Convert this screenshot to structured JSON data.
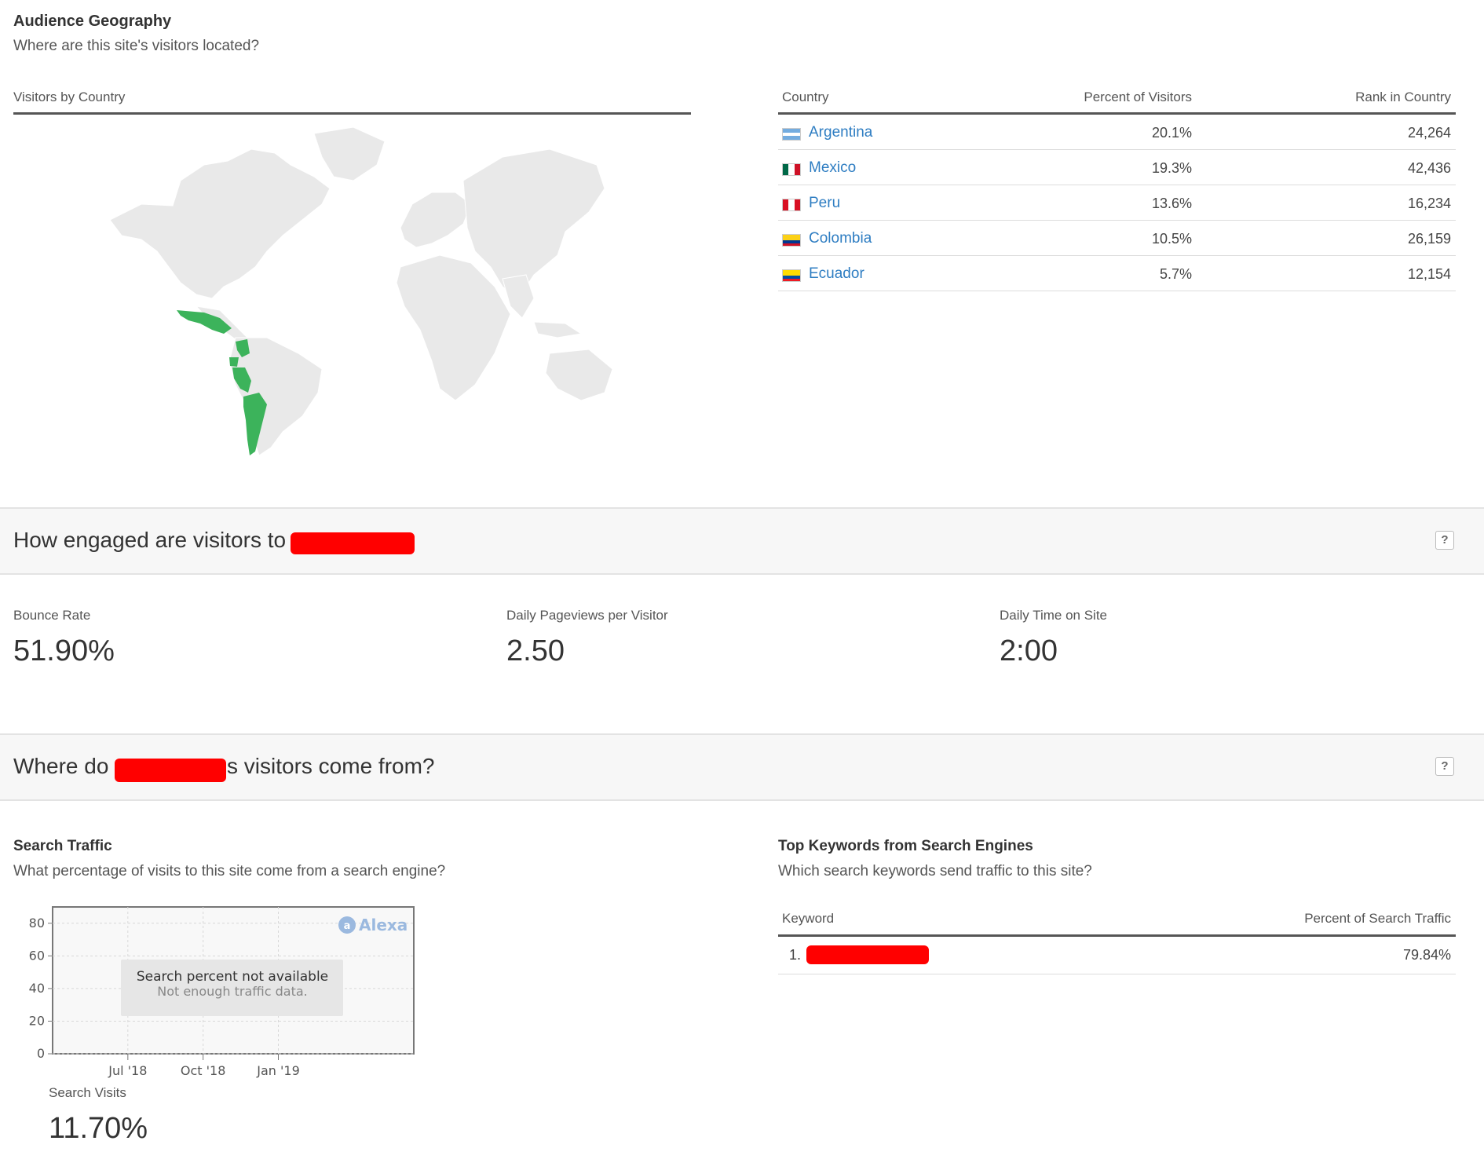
{
  "geography": {
    "title": "Audience Geography",
    "subtitle": "Where are this site's visitors located?",
    "map_label": "Visitors by Country",
    "columns": [
      "Country",
      "Percent of Visitors",
      "Rank in Country"
    ],
    "highlight_color": "#3cb35b",
    "land_color": "#e9e9e9",
    "rows": [
      {
        "country": "Argentina",
        "percent": "20.1%",
        "rank": "24,264",
        "flag": "argentina"
      },
      {
        "country": "Mexico",
        "percent": "19.3%",
        "rank": "42,436",
        "flag": "mexico"
      },
      {
        "country": "Peru",
        "percent": "13.6%",
        "rank": "16,234",
        "flag": "peru"
      },
      {
        "country": "Colombia",
        "percent": "10.5%",
        "rank": "26,159",
        "flag": "colombia"
      },
      {
        "country": "Ecuador",
        "percent": "5.7%",
        "rank": "12,154",
        "flag": "ecuador"
      }
    ]
  },
  "engagement": {
    "title": "How engaged are visitors to",
    "help": "?",
    "metrics": [
      {
        "label": "Bounce Rate",
        "value": "51.90%"
      },
      {
        "label": "Daily Pageviews per Visitor",
        "value": "2.50"
      },
      {
        "label": "Daily Time on Site",
        "value": "2:00"
      }
    ]
  },
  "sources": {
    "title_before": "Where do",
    "title_after": "s visitors come from?",
    "help": "?",
    "search": {
      "title": "Search Traffic",
      "subtitle": "What percentage of visits to this site come from a search engine?",
      "chart_msg_title": "Search percent not available",
      "chart_msg_sub": "Not enough traffic data.",
      "brand": "Alexa",
      "visits_label": "Search Visits",
      "visits_value": "11.70%"
    },
    "keywords": {
      "title": "Top Keywords from Search Engines",
      "subtitle": "Which search keywords send traffic to this site?",
      "columns": [
        "Keyword",
        "Percent of Search Traffic"
      ],
      "rows": [
        {
          "index": "1.",
          "percent": "79.84%"
        }
      ]
    }
  },
  "chart_data": {
    "type": "line",
    "x_tick_labels": [
      "Jul '18",
      "Oct '18",
      "Jan '19"
    ],
    "y_ticks": [
      0,
      20,
      40,
      60,
      80
    ],
    "ylim": [
      0,
      90
    ],
    "series": [],
    "grid": true,
    "annotations": [
      "Search percent not available",
      "Not enough traffic data."
    ]
  }
}
